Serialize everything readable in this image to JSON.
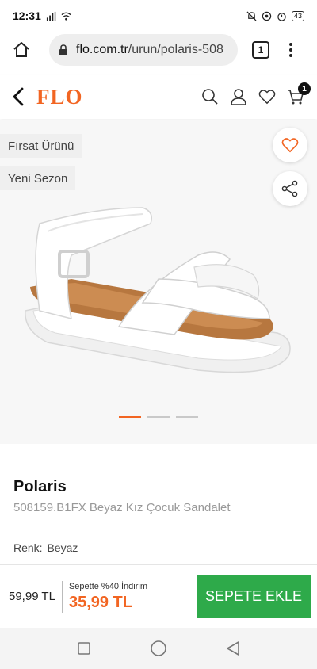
{
  "status_bar": {
    "time": "12:31",
    "battery": "43"
  },
  "browser": {
    "url_domain": "flo.com.tr",
    "url_path": "/urun/polaris-508",
    "tab_count": "1"
  },
  "site": {
    "logo": "FLO",
    "cart_count": "1"
  },
  "gallery": {
    "tags": [
      "Fırsat Ürünü",
      "Yeni Sezon"
    ],
    "slide_count": 3,
    "active_slide": 1
  },
  "product": {
    "name": "Polaris",
    "description": "508159.B1FX Beyaz Kız Çocuk Sandalet",
    "color_label": "Renk:",
    "color_value": "Beyaz"
  },
  "price_bar": {
    "old_price": "59,99 TL",
    "discount_label": "Sepette %40 İndirim",
    "new_price": "35,99 TL",
    "add_to_cart": "SEPETE EKLE"
  },
  "colors": {
    "brand": "#f26522",
    "cta": "#2eaa4a"
  }
}
